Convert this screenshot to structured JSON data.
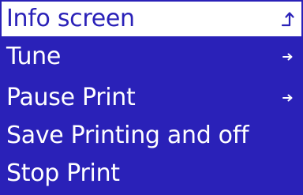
{
  "menu": {
    "items": [
      {
        "label": "Info screen",
        "icon": "back-arrow-icon",
        "selected": true
      },
      {
        "label": "Tune",
        "icon": "submenu-arrow-icon",
        "selected": false
      },
      {
        "label": "Pause Print",
        "icon": "submenu-arrow-icon",
        "selected": false
      },
      {
        "label": "Save Printing and off",
        "icon": "",
        "selected": false
      },
      {
        "label": "Stop Print",
        "icon": "",
        "selected": false
      }
    ]
  },
  "colors": {
    "background": "#2a21b8",
    "text": "#ffffff",
    "selected_background": "#ffffff",
    "selected_text": "#2a21b8"
  }
}
